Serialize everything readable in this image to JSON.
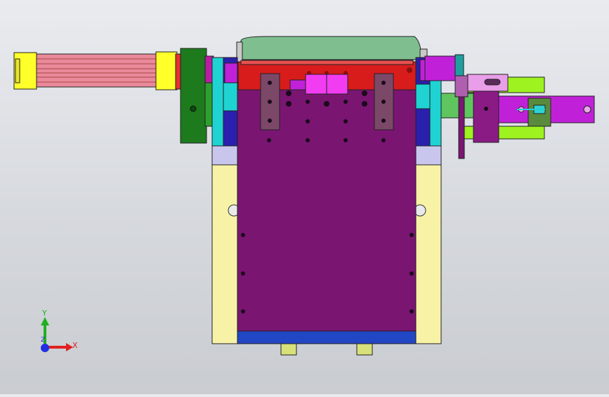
{
  "viewport": {
    "background_top": "#e9ebef",
    "background_bottom": "#c9ccd1"
  },
  "triad": {
    "x_label": "X",
    "y_label": "Y",
    "z_label": "Z",
    "x_color": "#e02020",
    "y_color": "#20b020",
    "z_color": "#2030e0"
  },
  "model": {
    "colors": {
      "main_plate": "#7a1572",
      "cyan_block": "#1fd3d3",
      "yellow_block": "#f7f2a6",
      "lavender_block": "#c9c6ee",
      "green_body": "#7fbf8f",
      "red_cap": "#d81c1c",
      "cylinder_pink": "#e98a9b",
      "cylinder_yellow": "#ffff2a",
      "dark_green": "#1d7a1d",
      "lime_rod": "#9ef21f",
      "magenta_part": "#c021d8",
      "bright_magenta": "#f23cf2",
      "blue_bar": "#2247c4",
      "clamp_purple": "#c982c9",
      "bracket_pink": "#e89ee8"
    }
  }
}
